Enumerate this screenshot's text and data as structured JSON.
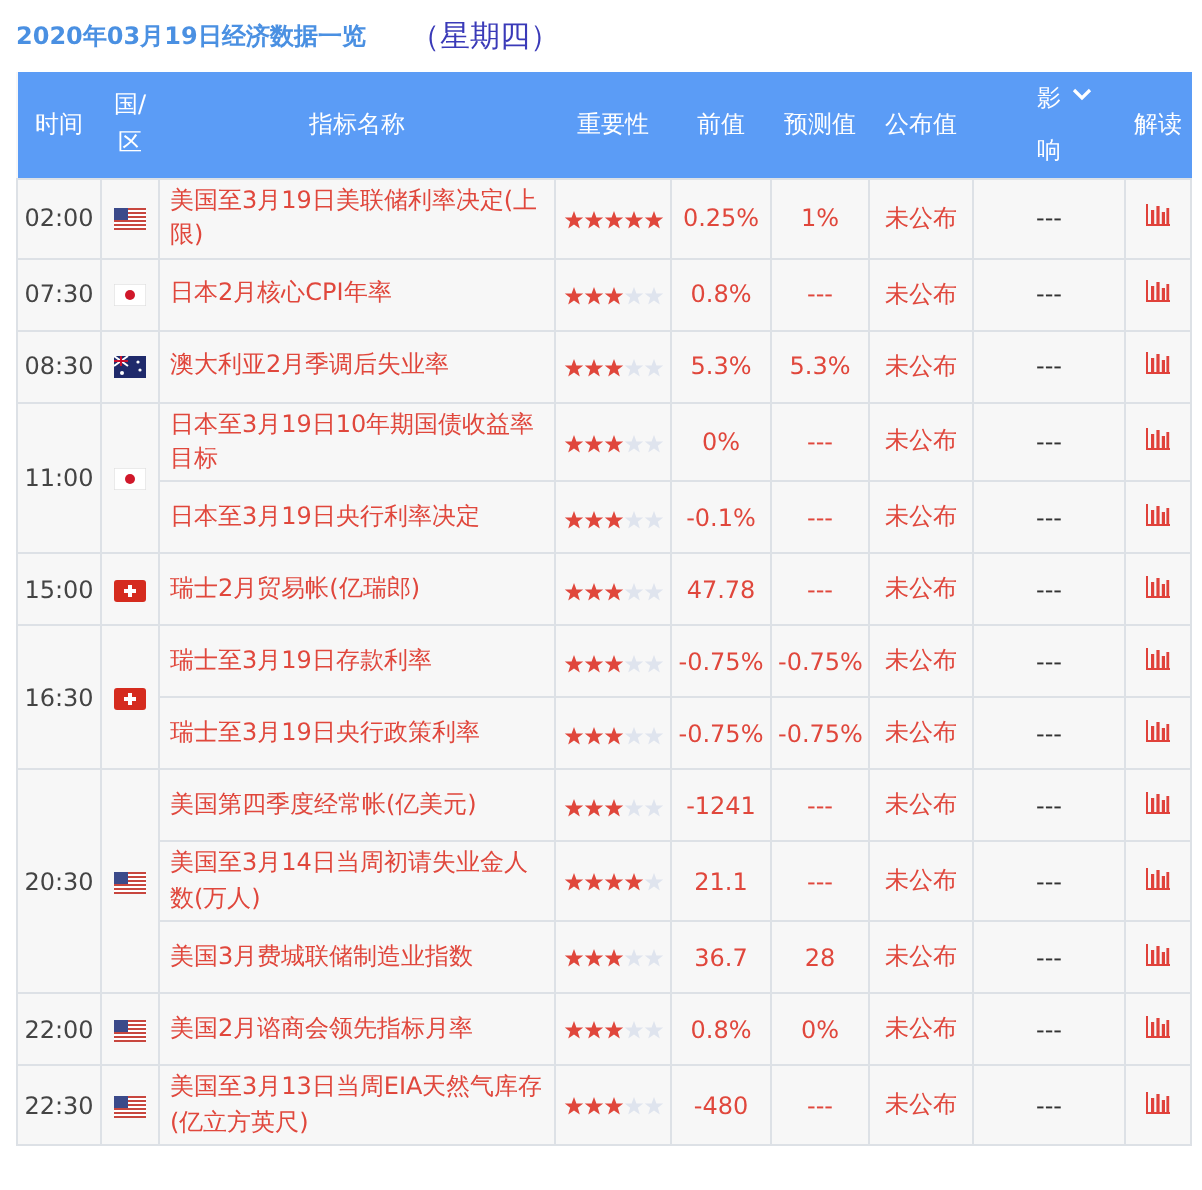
{
  "title": "2020年03月19日经济数据一览",
  "weekday": "（星期四）",
  "columns": [
    "时间",
    "国/区",
    "指标名称",
    "重要性",
    "前值",
    "预测值",
    "公布值",
    "影响",
    "解读"
  ],
  "groups": [
    {
      "time": "02:00",
      "kind": "us",
      "events": [
        {
          "name": "美国至3月19日美联储利率决定(上限)",
          "stars": 5,
          "previous": "0.25%",
          "forecast": "1%",
          "actual": "未公布",
          "impact": "---"
        }
      ]
    },
    {
      "time": "07:30",
      "kind": "jp",
      "events": [
        {
          "name": "日本2月核心CPI年率",
          "stars": 3,
          "previous": "0.8%",
          "forecast": "---",
          "actual": "未公布",
          "impact": "---"
        }
      ]
    },
    {
      "time": "08:30",
      "kind": "au",
      "events": [
        {
          "name": "澳大利亚2月季调后失业率",
          "stars": 3,
          "previous": "5.3%",
          "forecast": "5.3%",
          "actual": "未公布",
          "impact": "---"
        }
      ]
    },
    {
      "time": "11:00",
      "kind": "jp",
      "events": [
        {
          "name": "日本至3月19日10年期国债收益率目标",
          "stars": 3,
          "previous": "0%",
          "forecast": "---",
          "actual": "未公布",
          "impact": "---"
        },
        {
          "name": "日本至3月19日央行利率决定",
          "stars": 3,
          "previous": "-0.1%",
          "forecast": "---",
          "actual": "未公布",
          "impact": "---"
        }
      ]
    },
    {
      "time": "15:00",
      "kind": "ch",
      "events": [
        {
          "name": "瑞士2月贸易帐(亿瑞郎)",
          "stars": 3,
          "previous": "47.78",
          "forecast": "---",
          "actual": "未公布",
          "impact": "---"
        }
      ]
    },
    {
      "time": "16:30",
      "kind": "ch",
      "events": [
        {
          "name": "瑞士至3月19日存款利率",
          "stars": 3,
          "previous": "-0.75%",
          "forecast": "-0.75%",
          "actual": "未公布",
          "impact": "---"
        },
        {
          "name": "瑞士至3月19日央行政策利率",
          "stars": 3,
          "previous": "-0.75%",
          "forecast": "-0.75%",
          "actual": "未公布",
          "impact": "---"
        }
      ]
    },
    {
      "time": "20:30",
      "kind": "us",
      "events": [
        {
          "name": "美国第四季度经常帐(亿美元)",
          "stars": 3,
          "previous": "-1241",
          "forecast": "---",
          "actual": "未公布",
          "impact": "---"
        },
        {
          "name": "美国至3月14日当周初请失业金人数(万人)",
          "stars": 4,
          "previous": "21.1",
          "forecast": "---",
          "actual": "未公布",
          "impact": "---"
        },
        {
          "name": "美国3月费城联储制造业指数",
          "stars": 3,
          "previous": "36.7",
          "forecast": "28",
          "actual": "未公布",
          "impact": "---"
        }
      ]
    },
    {
      "time": "22:00",
      "kind": "us",
      "events": [
        {
          "name": "美国2月谘商会领先指标月率",
          "stars": 3,
          "previous": "0.8%",
          "forecast": "0%",
          "actual": "未公布",
          "impact": "---"
        }
      ]
    },
    {
      "time": "22:30",
      "kind": "us",
      "events": [
        {
          "name": "美国至3月13日当周EIA天然气库存(亿立方英尺)",
          "stars": 3,
          "previous": "-480",
          "forecast": "---",
          "actual": "未公布",
          "impact": "---"
        }
      ]
    }
  ]
}
